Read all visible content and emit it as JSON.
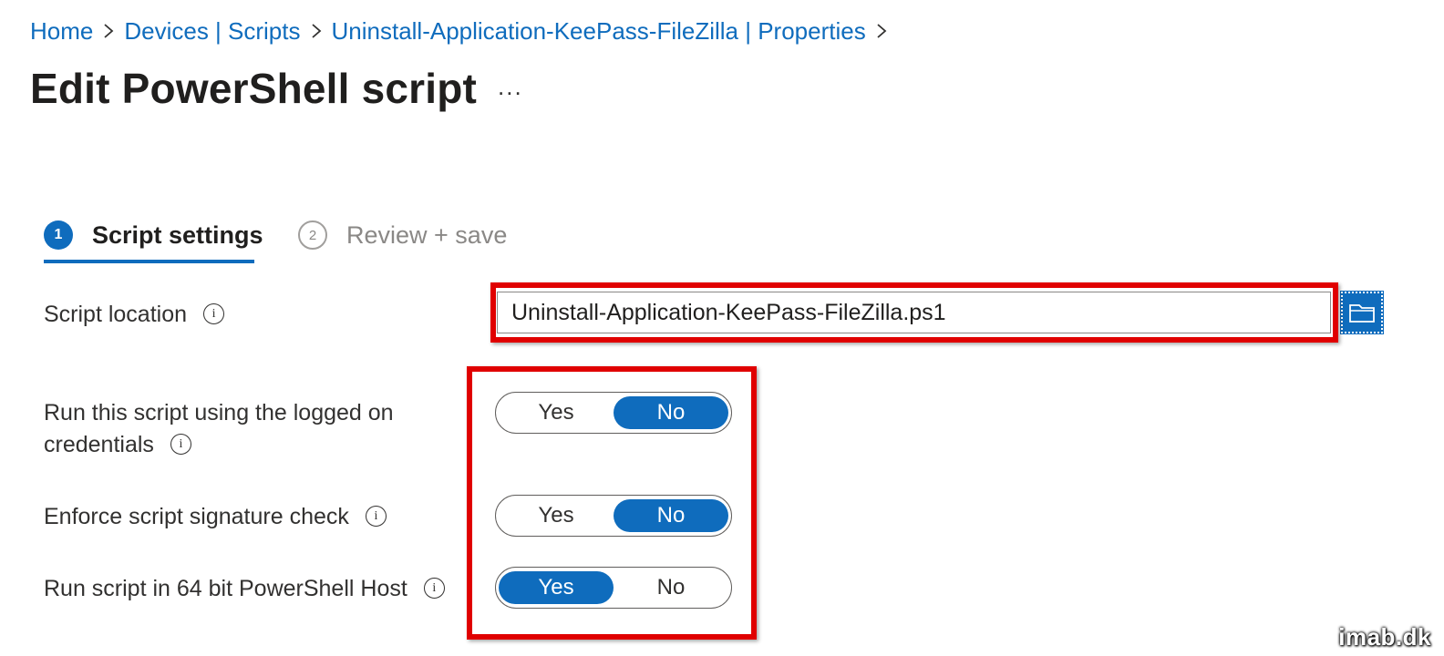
{
  "breadcrumb": {
    "items": [
      "Home",
      "Devices | Scripts",
      "Uninstall-Application-KeePass-FileZilla | Properties"
    ]
  },
  "page": {
    "title": "Edit PowerShell script",
    "more_label": "..."
  },
  "wizard": {
    "steps": [
      {
        "number": "1",
        "label": "Script settings",
        "active": true
      },
      {
        "number": "2",
        "label": "Review + save",
        "active": false
      }
    ]
  },
  "form": {
    "script_location": {
      "label": "Script location",
      "value": "Uninstall-Application-KeePass-FileZilla.ps1",
      "info_glyph": "i"
    },
    "logged_on_credentials": {
      "label_line1": "Run this script using the logged on",
      "label_line2": "credentials",
      "info_glyph": "i",
      "yes_label": "Yes",
      "no_label": "No",
      "selected": "No"
    },
    "signature_check": {
      "label": "Enforce script signature check",
      "info_glyph": "i",
      "yes_label": "Yes",
      "no_label": "No",
      "selected": "No"
    },
    "run_64bit": {
      "label": "Run script in 64 bit PowerShell Host",
      "info_glyph": "i",
      "yes_label": "Yes",
      "no_label": "No",
      "selected": "Yes"
    }
  },
  "watermark": "imab.dk",
  "colors": {
    "accent": "#0f6cbd",
    "highlight": "#e00000",
    "text": "#323130"
  },
  "icons": [
    "chevron-right-icon",
    "more-icon",
    "info-icon",
    "folder-browse-icon"
  ]
}
